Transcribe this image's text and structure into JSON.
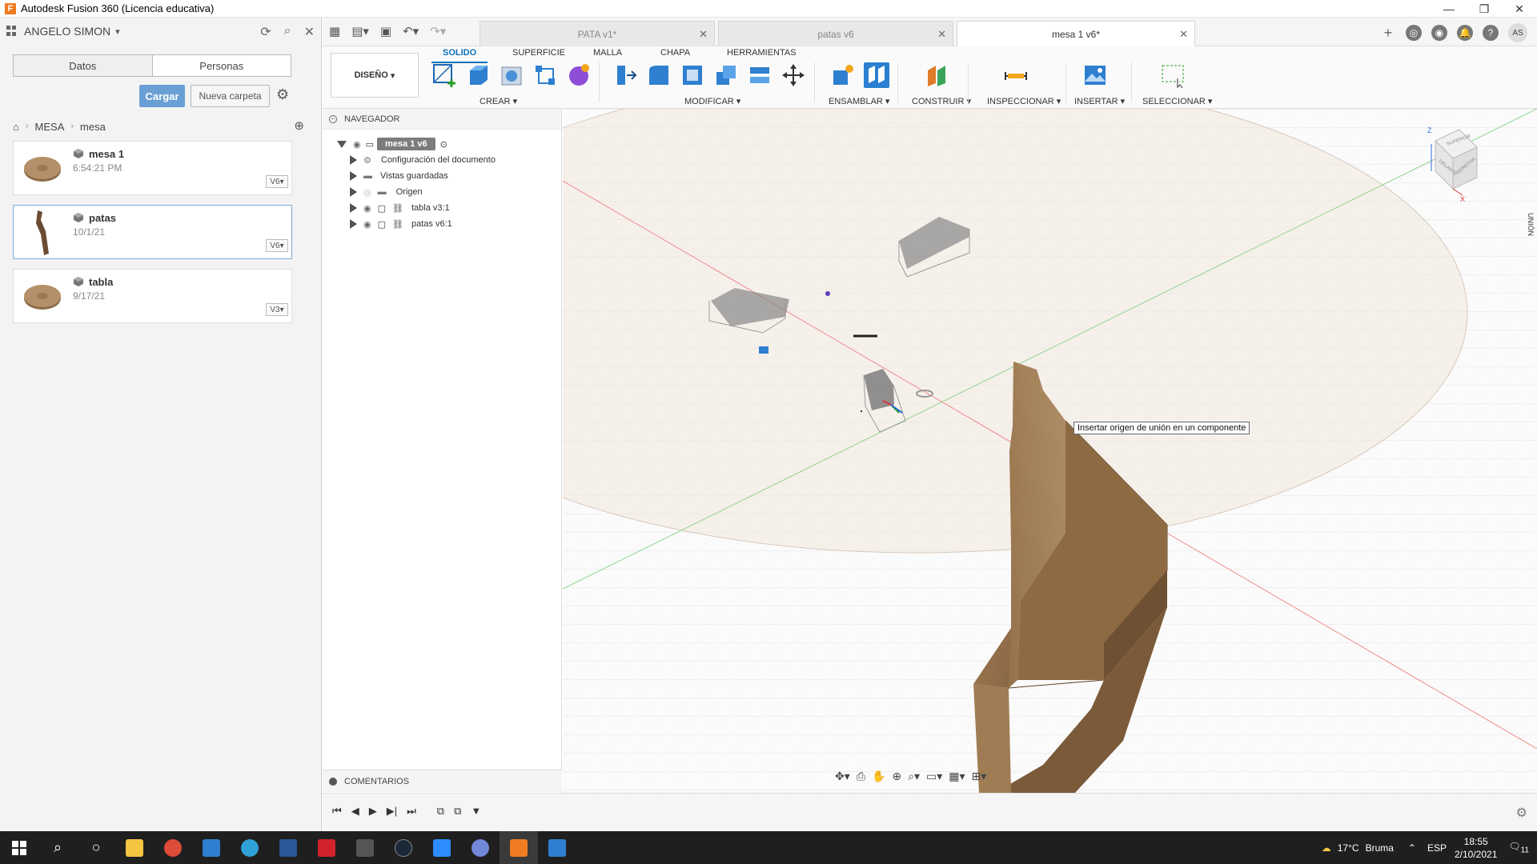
{
  "window": {
    "title": "Autodesk Fusion 360 (Licencia educativa)",
    "app_icon_letter": "F",
    "minimize": "—",
    "maximize": "❐",
    "close": "✕"
  },
  "data_panel": {
    "user": "ANGELO SIMON",
    "tabs": [
      "Datos",
      "Personas"
    ],
    "upload_button": "Cargar",
    "new_folder_button": "Nueva carpeta",
    "breadcrumb": [
      "MESA",
      "mesa"
    ],
    "files": [
      {
        "name": "mesa 1",
        "date": "6:54:21 PM",
        "version": "V6"
      },
      {
        "name": "patas",
        "date": "10/1/21",
        "version": "V6"
      },
      {
        "name": "tabla",
        "date": "9/17/21",
        "version": "V3"
      }
    ]
  },
  "doc_tabs": [
    {
      "label": "PATA v1*"
    },
    {
      "label": "patas v6"
    },
    {
      "label": "mesa 1 v6*"
    }
  ],
  "user_initials": "AS",
  "ribbon": {
    "workspace": "DISEÑO",
    "tabs": [
      "SOLIDO",
      "SUPERFICIE",
      "MALLA",
      "CHAPA",
      "HERRAMIENTAS"
    ],
    "groups": [
      "CREAR",
      "MODIFICAR",
      "ENSAMBLAR",
      "CONSTRUIR",
      "INSPECCIONAR",
      "INSERTAR",
      "SELECCIONAR"
    ]
  },
  "browser": {
    "title": "NAVEGADOR",
    "root": "mesa 1 v6",
    "items": [
      {
        "label": "Configuración del documento"
      },
      {
        "label": "Vistas guardadas"
      },
      {
        "label": "Origen"
      },
      {
        "label": "tabla v3:1"
      },
      {
        "label": "patas v6:1"
      }
    ],
    "comments": "COMENTARIOS"
  },
  "viewport": {
    "tooltip": "Insertar origen de unión en un componente",
    "side_tab": "UNIÓN",
    "view_cube": {
      "top": "SUPERIOR",
      "front": "DELANTE",
      "right": "DERECHA",
      "x": "X",
      "z": "Z"
    }
  },
  "taskbar": {
    "weather_temp": "17°C",
    "weather_text": "Bruma",
    "lang": "ESP",
    "time": "18:55",
    "date": "2/10/2021",
    "notif_count": "11"
  }
}
